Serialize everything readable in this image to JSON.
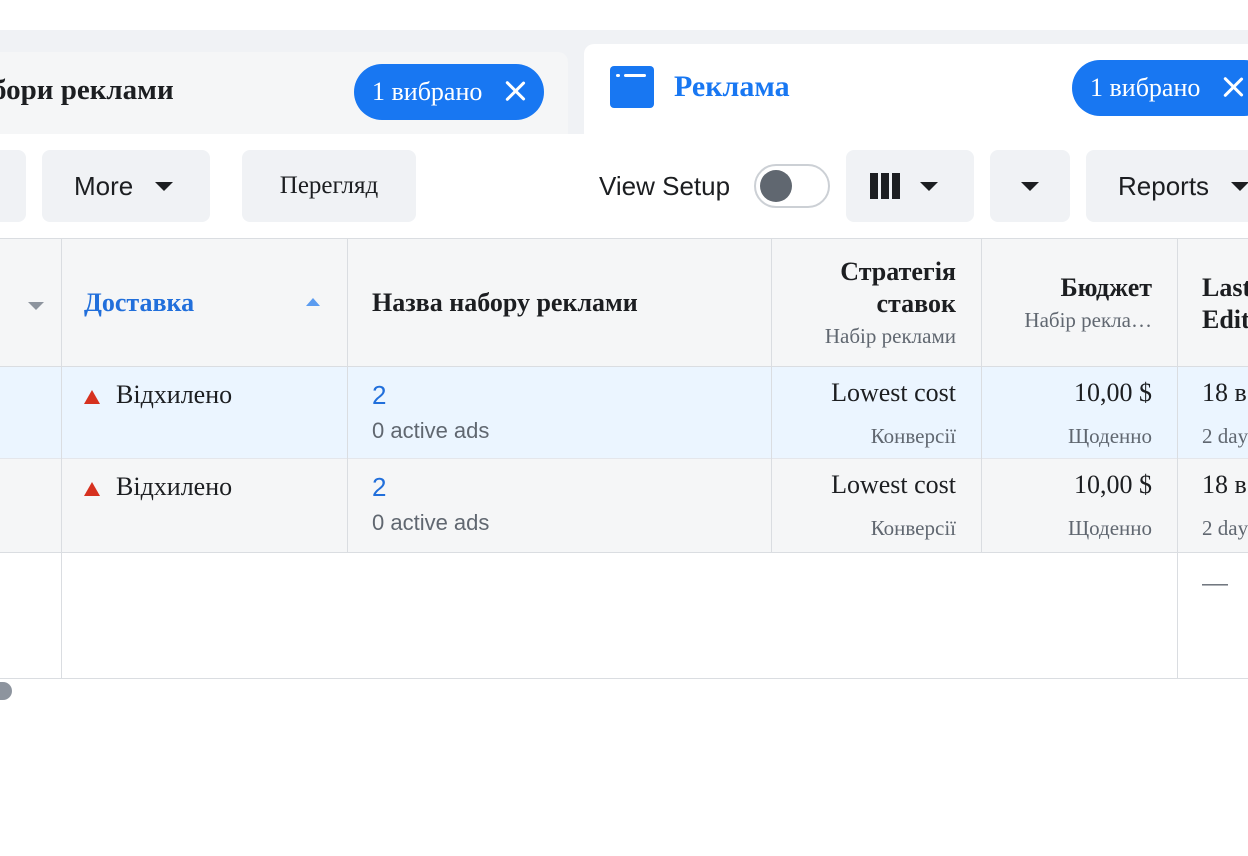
{
  "tabs": {
    "ad_sets": {
      "title": "бори реклами",
      "selected": "1 вибрано"
    },
    "ads": {
      "title": "Реклама",
      "selected": "1 вибрано"
    }
  },
  "toolbar": {
    "more_label": "More",
    "preview_label": "Перегляд",
    "view_setup_label": "View Setup",
    "view_setup_on": false,
    "reports_label": "Reports"
  },
  "table": {
    "columns": [
      {
        "title": "Доставка",
        "sorted": "ascending"
      },
      {
        "title": "Назва набору реклами"
      },
      {
        "title_line1": "Стратегія",
        "title_line2": "ставок",
        "subtitle": "Набір реклами"
      },
      {
        "title": "Бюджет",
        "subtitle": "Набір рекла…"
      },
      {
        "title_line1": "Last",
        "title_line2": "Edit"
      }
    ],
    "rows": [
      {
        "delivery": "Відхилено",
        "name": "2",
        "ads_count": "0 active ads",
        "strategy": "Lowest cost",
        "strategy_sub": "Конверсії",
        "budget": "10,00 $",
        "budget_sub": "Щоденно",
        "edited": "18 в",
        "edited_sub": "2 day"
      },
      {
        "delivery": "Відхилено",
        "name": "2",
        "ads_count": "0 active ads",
        "strategy": "Lowest cost",
        "strategy_sub": "Конверсії",
        "budget": "10,00 $",
        "budget_sub": "Щоденно",
        "edited": "18 в",
        "edited_sub": "2 day"
      }
    ],
    "summary_last_edit": "—"
  },
  "colors": {
    "accent": "#1877f2",
    "link": "#216fdb",
    "rejected": "#d6311f",
    "selected_row": "#ebf5ff",
    "row_bg": "#f5f6f7"
  }
}
